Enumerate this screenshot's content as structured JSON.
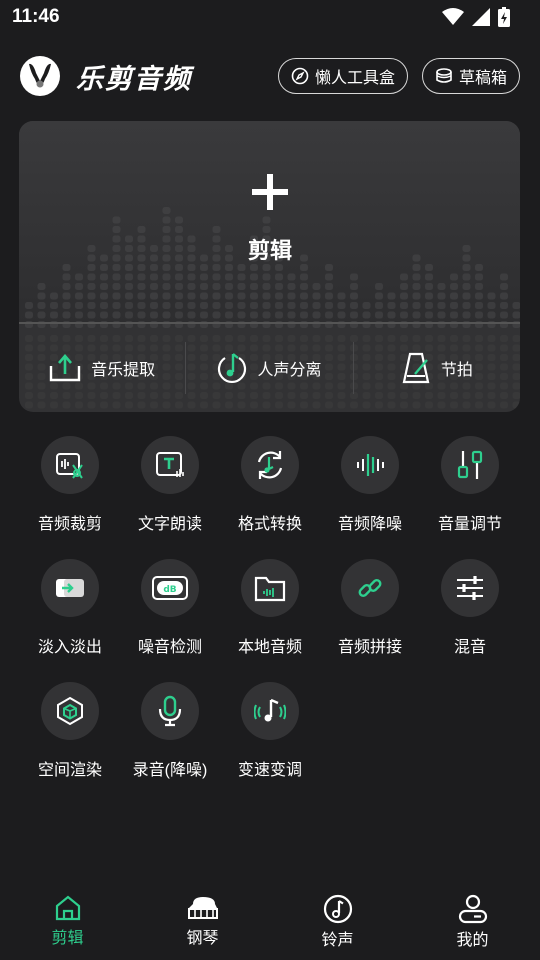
{
  "status": {
    "time": "11:46"
  },
  "header": {
    "brand": "乐剪音频",
    "toolbox_label": "懒人工具盒",
    "drafts_label": "草稿箱"
  },
  "card": {
    "edit_label": "剪辑",
    "tools": [
      {
        "label": "音乐提取",
        "icon": "upload-icon"
      },
      {
        "label": "人声分离",
        "icon": "music-note-circle-icon"
      },
      {
        "label": "节拍",
        "icon": "metronome-icon"
      }
    ]
  },
  "tools": [
    {
      "label": "音频裁剪",
      "icon": "audio-cut-icon"
    },
    {
      "label": "文字朗读",
      "icon": "text-to-speech-icon"
    },
    {
      "label": "格式转换",
      "icon": "format-convert-icon"
    },
    {
      "label": "音频降噪",
      "icon": "waveform-icon"
    },
    {
      "label": "音量调节",
      "icon": "volume-sliders-icon"
    },
    {
      "label": "淡入淡出",
      "icon": "fade-icon"
    },
    {
      "label": "噪音检测",
      "icon": "db-meter-icon"
    },
    {
      "label": "本地音频",
      "icon": "folder-audio-icon"
    },
    {
      "label": "音频拼接",
      "icon": "link-icon"
    },
    {
      "label": "混音",
      "icon": "mixer-icon"
    },
    {
      "label": "空间渲染",
      "icon": "cube-icon"
    },
    {
      "label": "录音(降噪)",
      "icon": "microphone-icon"
    },
    {
      "label": "变速变调",
      "icon": "pitch-icon"
    }
  ],
  "nav": [
    {
      "label": "剪辑",
      "icon": "home-icon",
      "active": true
    },
    {
      "label": "钢琴",
      "icon": "piano-icon",
      "active": false
    },
    {
      "label": "铃声",
      "icon": "disc-note-icon",
      "active": false
    },
    {
      "label": "我的",
      "icon": "user-icon",
      "active": false
    }
  ],
  "colors": {
    "accent": "#2ecf8e",
    "background": "#1c1c1e",
    "card": "#323234"
  }
}
